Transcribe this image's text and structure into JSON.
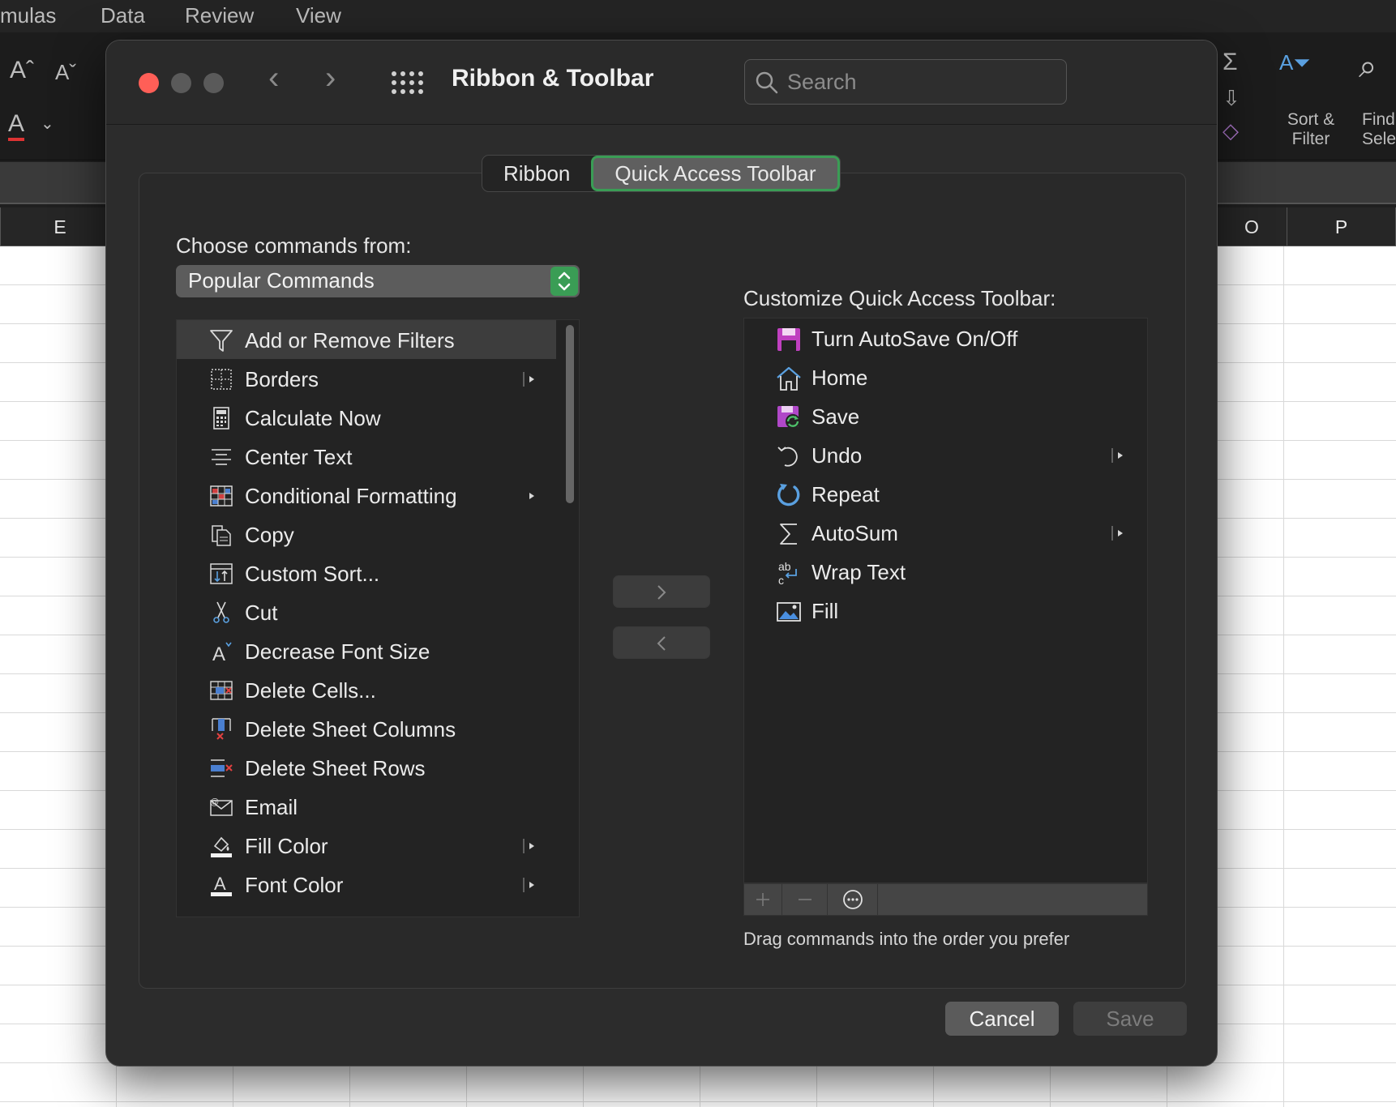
{
  "excel": {
    "menu": [
      "mulas",
      "Data",
      "Review",
      "View"
    ],
    "columns": {
      "left": "E",
      "right_o": "O",
      "right_p": "P"
    },
    "ribbon": {
      "sort_filter_line1": "Sort &",
      "sort_filter_line2": "Filter",
      "find_line1": "Find",
      "find_line2": "Sele"
    }
  },
  "dialog": {
    "title": "Ribbon & Toolbar",
    "search": {
      "placeholder": "Search"
    },
    "tabs": [
      {
        "label": "Ribbon",
        "active": false
      },
      {
        "label": "Quick Access Toolbar",
        "active": true
      }
    ],
    "choose_label": "Choose commands from:",
    "commands_select": {
      "value": "Popular Commands"
    },
    "commands": [
      {
        "label": "Add or Remove Filters",
        "icon": "filter-icon",
        "submenu": false,
        "selected": true
      },
      {
        "label": "Borders",
        "icon": "borders-icon",
        "submenu": true
      },
      {
        "label": "Calculate Now",
        "icon": "calculator-icon",
        "submenu": false
      },
      {
        "label": "Center Text",
        "icon": "center-align-icon",
        "submenu": false
      },
      {
        "label": "Conditional Formatting",
        "icon": "conditional-formatting-icon",
        "submenu": true
      },
      {
        "label": "Copy",
        "icon": "copy-icon",
        "submenu": false
      },
      {
        "label": "Custom Sort...",
        "icon": "custom-sort-icon",
        "submenu": false
      },
      {
        "label": "Cut",
        "icon": "scissors-icon",
        "submenu": false
      },
      {
        "label": "Decrease Font Size",
        "icon": "decrease-font-icon",
        "submenu": false
      },
      {
        "label": "Delete Cells...",
        "icon": "delete-cells-icon",
        "submenu": false
      },
      {
        "label": "Delete Sheet Columns",
        "icon": "delete-columns-icon",
        "submenu": false
      },
      {
        "label": "Delete Sheet Rows",
        "icon": "delete-rows-icon",
        "submenu": false
      },
      {
        "label": "Email",
        "icon": "email-icon",
        "submenu": false
      },
      {
        "label": "Fill Color",
        "icon": "fill-color-icon",
        "submenu": true
      },
      {
        "label": "Font Color",
        "icon": "font-color-icon",
        "submenu": true
      }
    ],
    "customize_label": "Customize Quick Access Toolbar:",
    "toolbar_items": [
      {
        "label": "Turn AutoSave On/Off",
        "icon": "autosave-icon",
        "submenu": false
      },
      {
        "label": "Home",
        "icon": "home-icon",
        "submenu": false
      },
      {
        "label": "Save",
        "icon": "save-sync-icon",
        "submenu": false
      },
      {
        "label": "Undo",
        "icon": "undo-icon",
        "submenu": true
      },
      {
        "label": "Repeat",
        "icon": "repeat-icon",
        "submenu": false
      },
      {
        "label": "AutoSum",
        "icon": "sigma-icon",
        "submenu": true
      },
      {
        "label": "Wrap Text",
        "icon": "wrap-text-icon",
        "submenu": false
      },
      {
        "label": "Fill",
        "icon": "fill-picture-icon",
        "submenu": false
      }
    ],
    "drag_hint": "Drag commands into the order you prefer",
    "buttons": {
      "cancel": "Cancel",
      "save": "Save"
    }
  },
  "colors": {
    "accent_green": "#3a9d55",
    "dialog_bg": "#2c2c2c",
    "traffic_close": "#ff5f57"
  }
}
